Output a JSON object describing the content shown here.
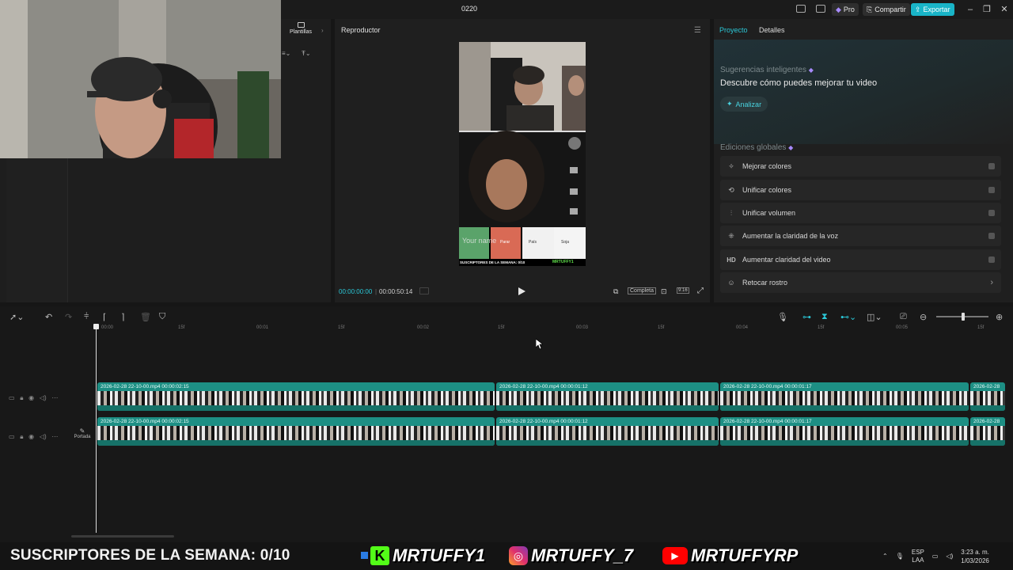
{
  "window": {
    "title": "0220"
  },
  "titlebar": {
    "pro_label": "Pro",
    "share_label": "Compartir",
    "export_label": "Exportar"
  },
  "left": {
    "templates_label": "Plantillas"
  },
  "player": {
    "title": "Reproductor",
    "timecode_current": "00:00:00:00",
    "timecode_total": "00:00:50:14",
    "ratio_label": "Completa",
    "aspect_label": "9:16",
    "overlay": {
      "your_name": "Your name",
      "options": [
        "Parar",
        "País",
        "Soja"
      ],
      "subs_caption": "SUSCRIPTORES DE LA SEMANA: 0/10",
      "watermark": "MRTUFFY1"
    }
  },
  "project_panel": {
    "tab_project": "Proyecto",
    "tab_details": "Detalles",
    "smart_label": "Sugerencias inteligentes",
    "smart_desc": "Descubre cómo puedes mejorar tu video",
    "analyze_label": "Analizar",
    "global_label": "Ediciones globales",
    "edits": [
      {
        "label": "Mejorar colores",
        "icon": "magic-wand-icon"
      },
      {
        "label": "Unificar colores",
        "icon": "color-match-icon"
      },
      {
        "label": "Unificar volumen",
        "icon": "volume-sliders-icon"
      },
      {
        "label": "Aumentar la claridad de la voz",
        "icon": "voice-icon"
      },
      {
        "label": "Aumentar claridad del video",
        "icon": "hd-icon"
      },
      {
        "label": "Retocar rostro",
        "icon": "face-retouch-icon"
      }
    ]
  },
  "timeline": {
    "ruler": [
      "00:00",
      "15f",
      "00:01",
      "15f",
      "00:02",
      "15f",
      "00:03",
      "15f",
      "00:04",
      "15f",
      "00:05",
      "15f"
    ],
    "cover_label": "Portada",
    "tracks": [
      {
        "clips": [
          {
            "title": "2026-02-28 22-10-00.mp4   00:00:02:15"
          },
          {
            "title": "2026-02-28 22-10-00.mp4   00:00:01:12"
          },
          {
            "title": "2026-02-28 22-10-00.mp4   00:00:01:17"
          },
          {
            "title": "2026-02-28"
          }
        ]
      },
      {
        "clips": [
          {
            "title": "2026-02-28 22-10-00.mp4   00:00:02:15"
          },
          {
            "title": "2026-02-28 22-10-00.mp4   00:00:01:12"
          },
          {
            "title": "2026-02-28 22-10-00.mp4   00:00:01:17"
          },
          {
            "title": "2026-02-28"
          }
        ]
      }
    ]
  },
  "stream_banner": {
    "subs_text": "SUSCRIPTORES DE LA SEMANA: 0/10",
    "kick_handle": "MRTUFFY1",
    "instagram_handle": "MRTUFFY_7",
    "youtube_handle": "MRTUFFYRP"
  },
  "taskbar": {
    "lang_top": "ESP",
    "lang_bottom": "LAA",
    "time": "3:23 a. m.",
    "date": "1/03/2026"
  },
  "colors": {
    "accent": "#2bc8d8",
    "clip": "#1d8f84",
    "export": "#19b4c7"
  }
}
